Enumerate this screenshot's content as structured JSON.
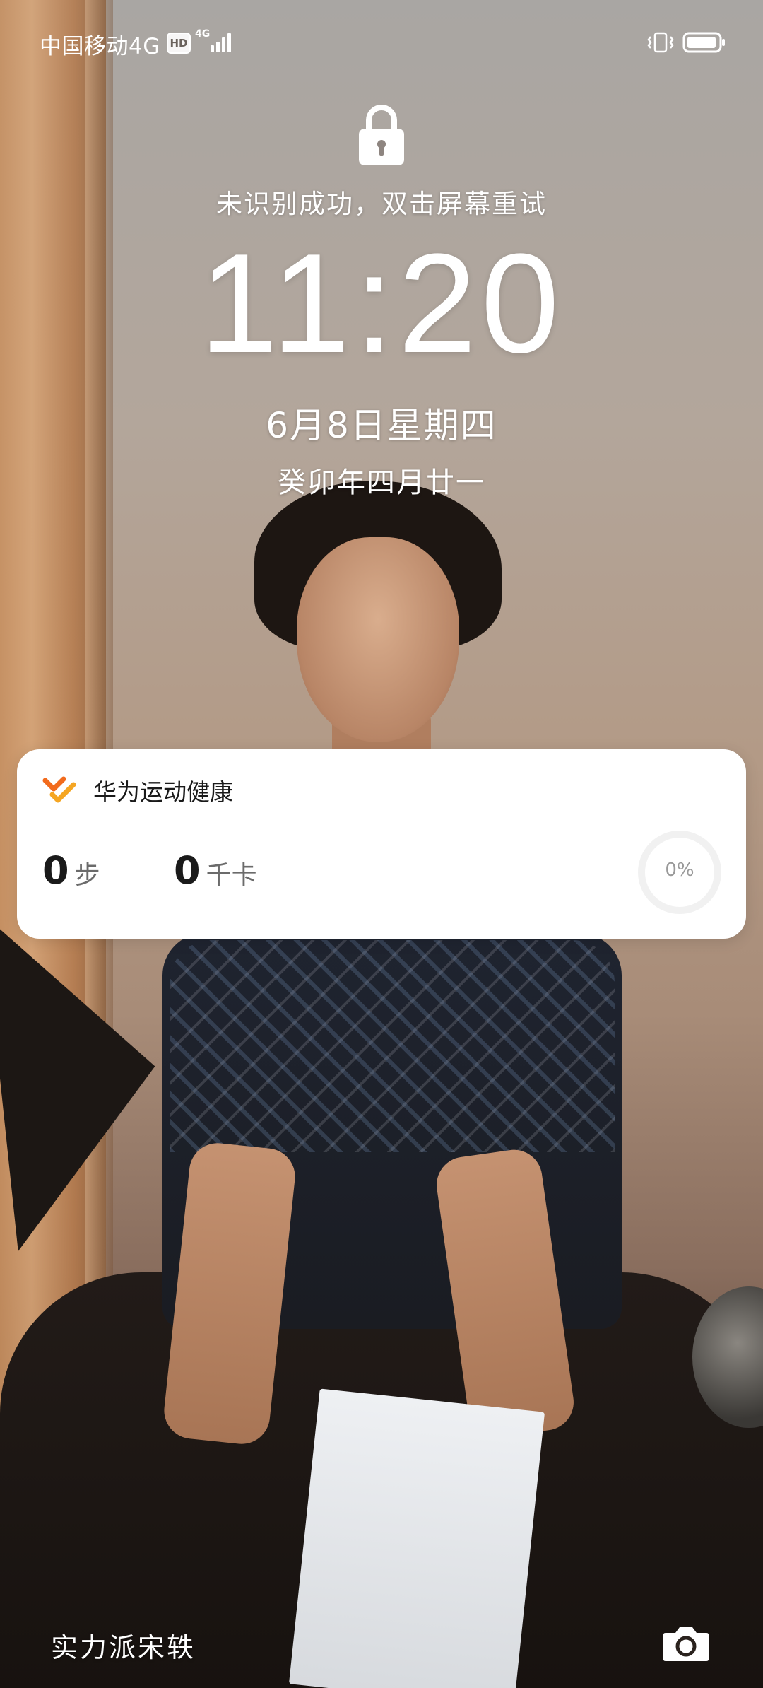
{
  "status_bar": {
    "carrier": "中国移动4G",
    "hd_badge": "HD",
    "network_type": "4G",
    "icons": [
      "signal-icon",
      "vibrate-icon",
      "battery-icon"
    ]
  },
  "lock_screen": {
    "lock_icon": "lock-icon",
    "unlock_message": "未识别成功，双击屏幕重试",
    "time": "11:20",
    "date": "6月8日星期四",
    "lunar_date": "癸卯年四月廿一"
  },
  "health_widget": {
    "app_name": "华为运动健康",
    "steps_value": "0",
    "steps_unit": "步",
    "calories_value": "0",
    "calories_unit": "千卡",
    "progress_label": "0%",
    "progress": 0,
    "accent_color": "#f26b1d"
  },
  "footer": {
    "signature": "实力派宋轶",
    "camera_icon": "camera-icon"
  }
}
